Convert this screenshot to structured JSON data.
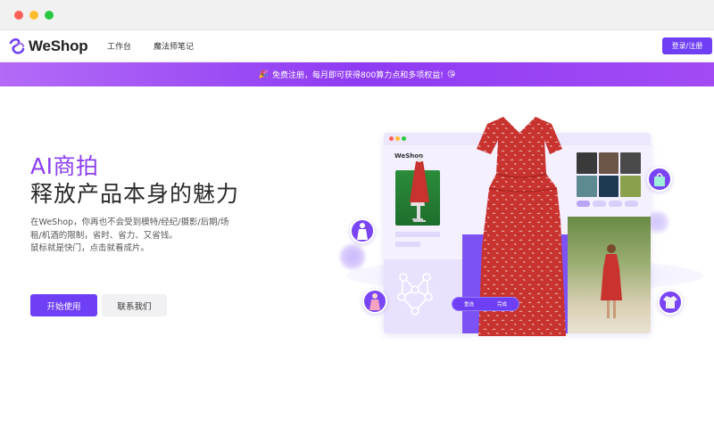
{
  "window": {
    "controls": [
      "close",
      "minimize",
      "maximize"
    ]
  },
  "navbar": {
    "logo_text": "WeShop",
    "links": [
      "工作台",
      "魔法师笔记"
    ],
    "login_label": "登录/注册"
  },
  "promo": {
    "text": "免费注册，每月即可获得800算力点和多项权益!",
    "left_emoji": "🎉",
    "right_emoji": "😘"
  },
  "hero": {
    "headline_accent": "AI商拍",
    "headline_main": "释放产品本身的魅力",
    "description": [
      "在WeShop，你再也不会受到模特/经纪/摄影/后期/场",
      "租/机酒的限制，省时、省力、又省钱。",
      "鼠标就是快门，点击就看成片。"
    ],
    "primary_button": "开始使用",
    "secondary_button": "联系我们"
  },
  "illustration": {
    "mock_logo": "WeShop",
    "control_left": "重选",
    "control_right": "完成",
    "icons": [
      "avatar-model-icon",
      "avatar-dress-icon",
      "shopping-bag-icon",
      "shirt-icon",
      "neural-network-icon"
    ]
  },
  "colors": {
    "brand": "#6f3ff5",
    "accent_text": "#8b3ff0",
    "promo_gradient_start": "#b36bf6",
    "promo_gradient_end": "#8f3bf3",
    "dress_red": "#c8322f"
  }
}
